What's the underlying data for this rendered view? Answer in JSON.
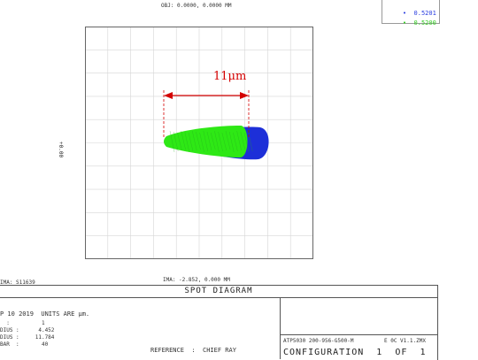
{
  "header": {
    "obj_label": "OBJ: 0.0000, 0.0000 MM"
  },
  "legend": [
    {
      "marker": "•",
      "value": "0.5201",
      "color": "#2a3de0"
    },
    {
      "marker": "•",
      "value": "0.5200",
      "color": "#33cc22"
    }
  ],
  "plot": {
    "y_axis_label": "+0.00",
    "ima_label": "IMA: -2.852, 0.000 MM",
    "ima_side_label": "IMA: S11639",
    "annotation": "11μm",
    "colors": {
      "annotation": "#d40000",
      "grid": "#d6d6d6",
      "frame": "#666666",
      "blue": "#1d2fd8",
      "green": "#2ee815"
    }
  },
  "title_band": {
    "label": "SPOT DIAGRAM"
  },
  "info": {
    "line1": "P 10 2019  UNITS ARE μm.",
    "line2": "  :          1",
    "line3": "DIUS :      4.452",
    "line4": "DIUS :     11.784",
    "line5": "BAR  :       40",
    "reference": "REFERENCE  :  CHIEF RAY"
  },
  "footer": {
    "file": "ATP5030 200-956-G500-M",
    "version": "E 0C V1.1.ZMX",
    "configuration": "CONFIGURATION  1  OF  1"
  }
}
